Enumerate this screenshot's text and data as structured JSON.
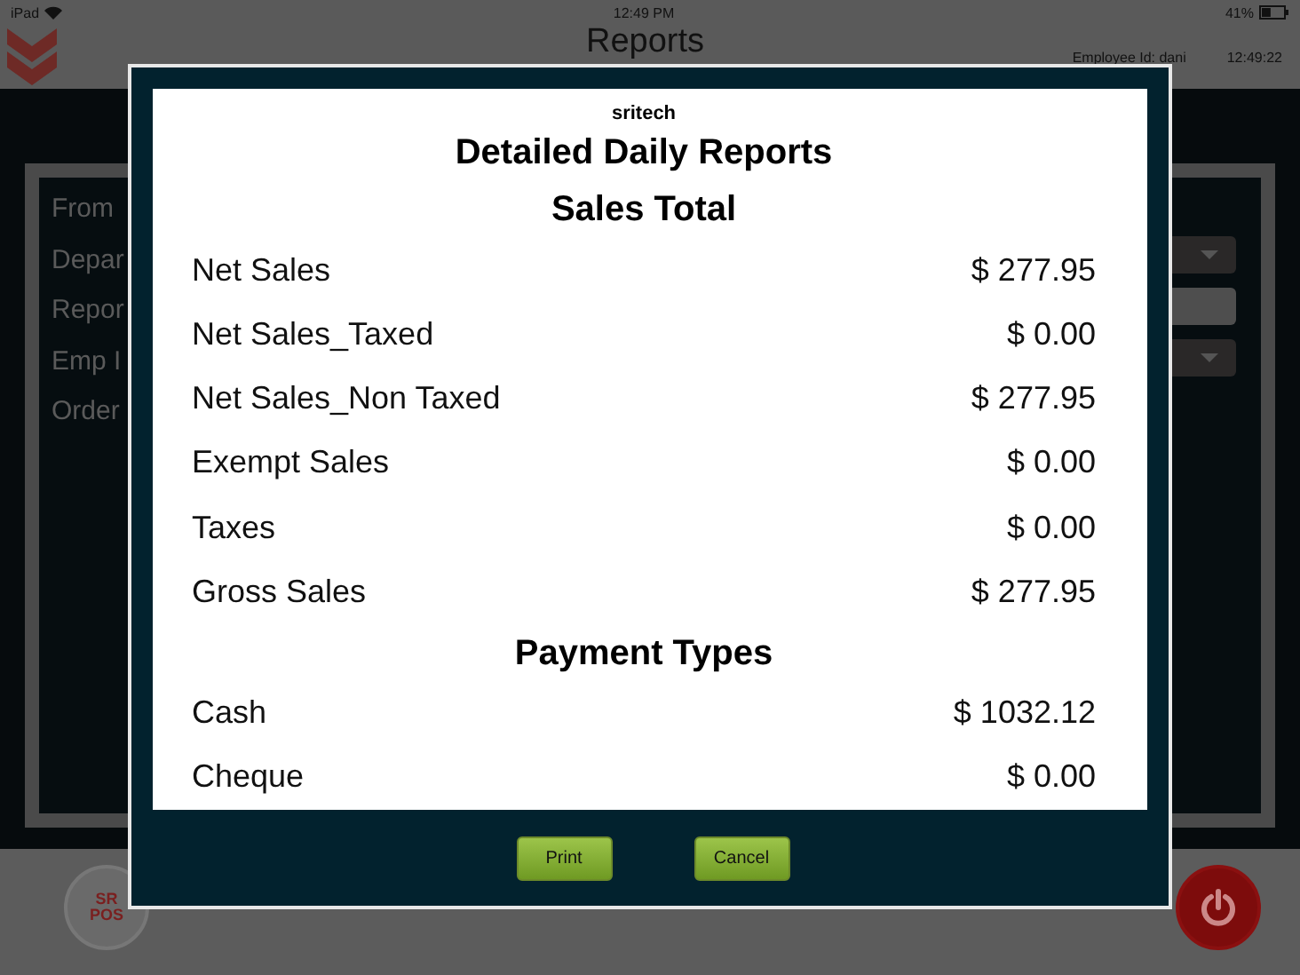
{
  "status_bar": {
    "device": "iPad",
    "time": "12:49 PM",
    "battery": "41%"
  },
  "header": {
    "title": "Reports",
    "employee": "Employee Id: dani",
    "clock": "12:49:22"
  },
  "filter_labels": [
    "From",
    "Depar",
    "Repor",
    "Emp I",
    "Order"
  ],
  "filter_controls": [
    {
      "kind": "dropdown"
    },
    {
      "kind": "field"
    },
    {
      "kind": "dropdown"
    }
  ],
  "logo": {
    "top": "SR",
    "bottom": "POS"
  },
  "dialog": {
    "company": "sritech",
    "title": "Detailed Daily Reports",
    "sections": [
      {
        "heading": "Sales Total",
        "rows": [
          {
            "label": "Net Sales",
            "value": "$ 277.95"
          },
          {
            "label": "Net Sales_Taxed",
            "value": "$ 0.00"
          },
          {
            "label": "Net Sales_Non Taxed",
            "value": "$ 277.95"
          },
          {
            "label": "Exempt Sales",
            "value": "$ 0.00"
          },
          {
            "label": "Taxes",
            "value": "$ 0.00"
          },
          {
            "label": "Gross Sales",
            "value": "$ 277.95"
          }
        ]
      },
      {
        "heading": "Payment Types",
        "rows": [
          {
            "label": "Cash",
            "value": "$ 1032.12"
          },
          {
            "label": "Cheque",
            "value": "$ 0.00"
          }
        ]
      }
    ],
    "buttons": [
      "Print",
      "Cancel"
    ]
  }
}
